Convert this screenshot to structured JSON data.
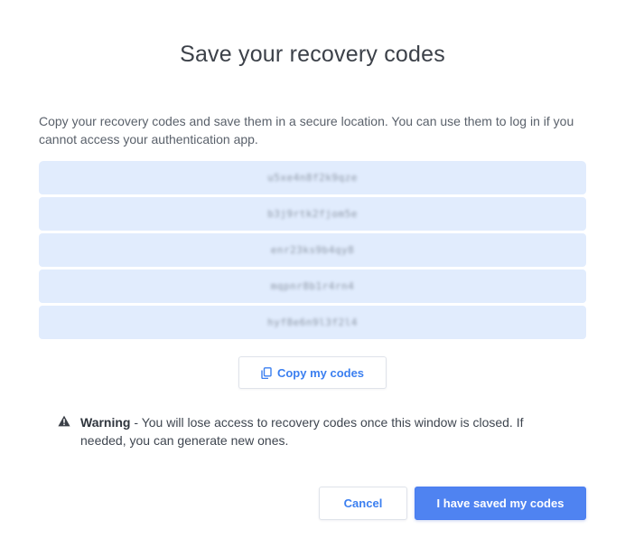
{
  "dialog": {
    "title": "Save your recovery codes",
    "description": "Copy your recovery codes and save them in a secure location. You can use them to log in if you cannot access your authentication app.",
    "codes": [
      "u5xe4n8f2k9qze",
      "b3j9rtk2fjom5e",
      "enr23ks9b4qy8",
      "mqpnr8b1r4rn4",
      "hyf8e6n9l3f2l4"
    ],
    "copy_button_label": "Copy my codes",
    "copy_icon": "copy-icon",
    "warning": {
      "icon": "warning-triangle-icon",
      "title": "Warning",
      "separator": " - ",
      "text": "You will lose access to recovery codes once this window is closed. If needed, you can generate new ones."
    },
    "cancel_label": "Cancel",
    "confirm_label": "I have saved my codes"
  },
  "colors": {
    "accent": "#3b7ff0",
    "primary_button": "#4f83f1",
    "code_row_bg": "#e1ecfd"
  }
}
